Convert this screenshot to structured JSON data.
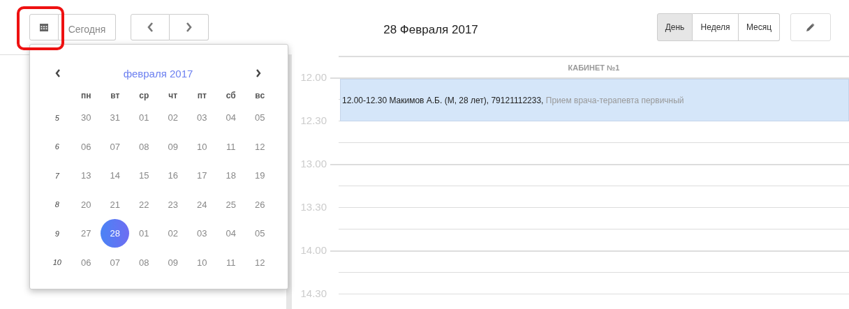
{
  "toolbar": {
    "today_button": "Сегодня",
    "title": "28 Февраля 2017",
    "views": [
      {
        "label": "День",
        "selected": true
      },
      {
        "label": "Неделя",
        "selected": false
      },
      {
        "label": "Месяц",
        "selected": false
      }
    ]
  },
  "datepicker": {
    "month_title": "февраля 2017",
    "weekdays": [
      "пн",
      "вт",
      "ср",
      "чт",
      "пт",
      "сб",
      "вс"
    ],
    "weeks": [
      {
        "number": "5",
        "days": [
          {
            "label": "30",
            "selected": false
          },
          {
            "label": "31",
            "selected": false
          },
          {
            "label": "01",
            "selected": false
          },
          {
            "label": "02",
            "selected": false
          },
          {
            "label": "03",
            "selected": false
          },
          {
            "label": "04",
            "selected": false
          },
          {
            "label": "05",
            "selected": false
          }
        ]
      },
      {
        "number": "6",
        "days": [
          {
            "label": "06",
            "selected": false
          },
          {
            "label": "07",
            "selected": false
          },
          {
            "label": "08",
            "selected": false
          },
          {
            "label": "09",
            "selected": false
          },
          {
            "label": "10",
            "selected": false
          },
          {
            "label": "11",
            "selected": false
          },
          {
            "label": "12",
            "selected": false
          }
        ]
      },
      {
        "number": "7",
        "days": [
          {
            "label": "13",
            "selected": false
          },
          {
            "label": "14",
            "selected": false
          },
          {
            "label": "15",
            "selected": false
          },
          {
            "label": "16",
            "selected": false
          },
          {
            "label": "17",
            "selected": false
          },
          {
            "label": "18",
            "selected": false
          },
          {
            "label": "19",
            "selected": false
          }
        ]
      },
      {
        "number": "8",
        "days": [
          {
            "label": "20",
            "selected": false
          },
          {
            "label": "21",
            "selected": false
          },
          {
            "label": "22",
            "selected": false
          },
          {
            "label": "23",
            "selected": false
          },
          {
            "label": "24",
            "selected": false
          },
          {
            "label": "25",
            "selected": false
          },
          {
            "label": "26",
            "selected": false
          }
        ]
      },
      {
        "number": "9",
        "days": [
          {
            "label": "27",
            "selected": false
          },
          {
            "label": "28",
            "selected": true
          },
          {
            "label": "01",
            "selected": false
          },
          {
            "label": "02",
            "selected": false
          },
          {
            "label": "03",
            "selected": false
          },
          {
            "label": "04",
            "selected": false
          },
          {
            "label": "05",
            "selected": false
          }
        ]
      },
      {
        "number": "10",
        "days": [
          {
            "label": "06",
            "selected": false
          },
          {
            "label": "07",
            "selected": false
          },
          {
            "label": "08",
            "selected": false
          },
          {
            "label": "09",
            "selected": false
          },
          {
            "label": "10",
            "selected": false
          },
          {
            "label": "11",
            "selected": false
          },
          {
            "label": "12",
            "selected": false
          }
        ]
      }
    ]
  },
  "schedule": {
    "room": "КАБИНЕТ №1",
    "times": [
      "12.00",
      "12.30",
      "13.00",
      "13.30",
      "14.00",
      "14.30"
    ],
    "appointment": {
      "text": "12.00-12.30 Макимов А.Б. (М, 28 лет), 79121112233,",
      "service": "Прием врача-терапевта первичный"
    }
  }
}
